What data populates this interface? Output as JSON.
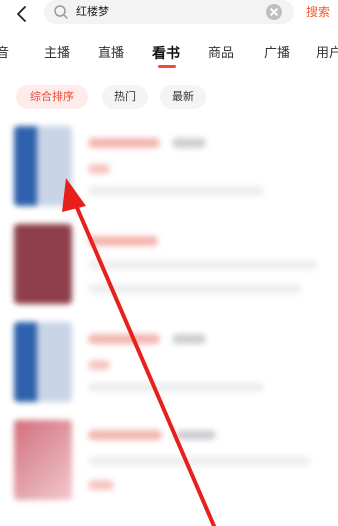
{
  "search": {
    "query": "红楼梦",
    "submit_label": "搜索"
  },
  "tabs": [
    {
      "label": "音",
      "active": false
    },
    {
      "label": "主播",
      "active": false
    },
    {
      "label": "直播",
      "active": false
    },
    {
      "label": "看书",
      "active": true
    },
    {
      "label": "商品",
      "active": false
    },
    {
      "label": "广播",
      "active": false
    },
    {
      "label": "用户",
      "active": false
    }
  ],
  "filters": [
    {
      "label": "综合排序",
      "active": true
    },
    {
      "label": "热门",
      "active": false
    },
    {
      "label": "最新",
      "active": false
    }
  ],
  "results": [
    {
      "cover_color": "#2f62ad"
    },
    {
      "cover_color": "#8f3f4a"
    },
    {
      "cover_color": "#2f62ad"
    },
    {
      "cover_color": "#d9a0a8"
    }
  ],
  "colors": {
    "accent": "#ef4a3a",
    "search_button": "#ef5a2a",
    "annotation_arrow": "#e8201c"
  },
  "icons": {
    "back": "chevron-left-icon",
    "search": "magnifier-icon",
    "clear": "clear-circle-icon"
  }
}
